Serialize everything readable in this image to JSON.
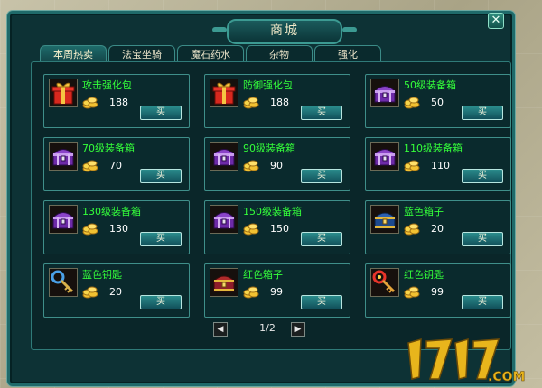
{
  "window": {
    "title": "商城",
    "close_symbol": "✕"
  },
  "tabs": [
    {
      "label": "本周热卖",
      "active": true
    },
    {
      "label": "法宝坐骑",
      "active": false
    },
    {
      "label": "魔石药水",
      "active": false
    },
    {
      "label": "杂物",
      "active": false
    },
    {
      "label": "强化",
      "active": false
    }
  ],
  "items": [
    {
      "name": "攻击强化包",
      "price": "188",
      "buy": "买",
      "icon": "gift-box-icon"
    },
    {
      "name": "防御强化包",
      "price": "188",
      "buy": "买",
      "icon": "gift-box-icon"
    },
    {
      "name": "50级装备箱",
      "price": "50",
      "buy": "买",
      "icon": "purple-chest-icon"
    },
    {
      "name": "70级装备箱",
      "price": "70",
      "buy": "买",
      "icon": "purple-chest-icon"
    },
    {
      "name": "90级装备箱",
      "price": "90",
      "buy": "买",
      "icon": "purple-chest-icon"
    },
    {
      "name": "110级装备箱",
      "price": "110",
      "buy": "买",
      "icon": "purple-chest-icon"
    },
    {
      "name": "130级装备箱",
      "price": "130",
      "buy": "买",
      "icon": "purple-chest-icon"
    },
    {
      "name": "150级装备箱",
      "price": "150",
      "buy": "买",
      "icon": "purple-chest-icon"
    },
    {
      "name": "蓝色箱子",
      "price": "20",
      "buy": "买",
      "icon": "blue-chest-icon"
    },
    {
      "name": "蓝色钥匙",
      "price": "20",
      "buy": "买",
      "icon": "blue-key-icon"
    },
    {
      "name": "红色箱子",
      "price": "99",
      "buy": "买",
      "icon": "red-chest-icon"
    },
    {
      "name": "红色钥匙",
      "price": "99",
      "buy": "买",
      "icon": "red-key-icon"
    }
  ],
  "pager": {
    "text": "1/2",
    "prev": "◀",
    "next": "▶"
  },
  "watermark": {
    "text": "17173.COM"
  },
  "colors": {
    "item_name": "#34ff3a",
    "panel": "#0d3235",
    "border": "#3f8f8a"
  }
}
